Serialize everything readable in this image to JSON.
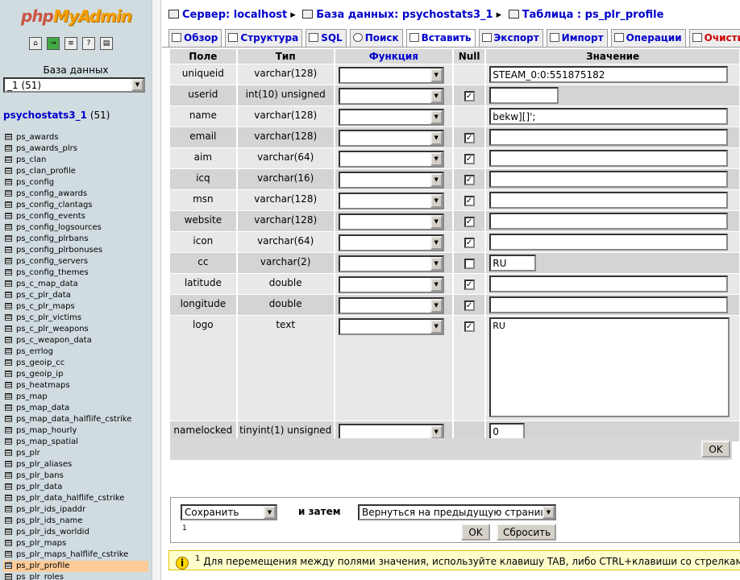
{
  "left": {
    "logo_php": "php",
    "logo_myadmin": "MyAdmin",
    "db_label": "База данных",
    "db_select": "_1 (51)",
    "db_name": "psychostats3_1",
    "db_count": "(51)",
    "tables": [
      "ps_awards",
      "ps_awards_plrs",
      "ps_clan",
      "ps_clan_profile",
      "ps_config",
      "ps_config_awards",
      "ps_config_clantags",
      "ps_config_events",
      "ps_config_logsources",
      "ps_config_plrbans",
      "ps_config_plrbonuses",
      "ps_config_servers",
      "ps_config_themes",
      "ps_c_map_data",
      "ps_c_plr_data",
      "ps_c_plr_maps",
      "ps_c_plr_victims",
      "ps_c_plr_weapons",
      "ps_c_weapon_data",
      "ps_errlog",
      "ps_geoip_cc",
      "ps_geoip_ip",
      "ps_heatmaps",
      "ps_map",
      "ps_map_data",
      "ps_map_data_halflife_cstrike",
      "ps_map_hourly",
      "ps_map_spatial",
      "ps_plr",
      "ps_plr_aliases",
      "ps_plr_bans",
      "ps_plr_data",
      "ps_plr_data_halflife_cstrike",
      "ps_plr_ids_ipaddr",
      "ps_plr_ids_name",
      "ps_plr_ids_worldid",
      "ps_plr_maps",
      "ps_plr_maps_halflife_cstrike",
      "ps_plr_profile",
      "ps_plr_roles"
    ],
    "selected_table": "ps_plr_profile"
  },
  "breadcrumb": {
    "server": "Сервер: localhost",
    "database": "База данных: psychostats3_1",
    "table": "Таблица : ps_plr_profile"
  },
  "tabs": [
    "Обзор",
    "Структура",
    "SQL",
    "Поиск",
    "Вставить",
    "Экспорт",
    "Импорт",
    "Операции",
    "Очисти"
  ],
  "active_tab": "Вставить",
  "columns": {
    "field": "Поле",
    "type": "Тип",
    "function": "Функция",
    "null": "Null",
    "value": "Значение"
  },
  "rows": [
    {
      "field": "uniqueid",
      "type": "varchar(128)",
      "null": false,
      "has_null": false,
      "value": "STEAM_0:0:551875182",
      "w": 296
    },
    {
      "field": "userid",
      "type": "int(10) unsigned",
      "null": true,
      "has_null": true,
      "value": "",
      "w": 86
    },
    {
      "field": "name",
      "type": "varchar(128)",
      "null": false,
      "has_null": false,
      "value": "bekw][]';",
      "w": 296
    },
    {
      "field": "email",
      "type": "varchar(128)",
      "null": true,
      "has_null": true,
      "value": "",
      "w": 296
    },
    {
      "field": "aim",
      "type": "varchar(64)",
      "null": true,
      "has_null": true,
      "value": "",
      "w": 296
    },
    {
      "field": "icq",
      "type": "varchar(16)",
      "null": true,
      "has_null": true,
      "value": "",
      "w": 296
    },
    {
      "field": "msn",
      "type": "varchar(128)",
      "null": true,
      "has_null": true,
      "value": "",
      "w": 296
    },
    {
      "field": "website",
      "type": "varchar(128)",
      "null": true,
      "has_null": true,
      "value": "",
      "w": 296
    },
    {
      "field": "icon",
      "type": "varchar(64)",
      "null": true,
      "has_null": true,
      "value": "",
      "w": 296
    },
    {
      "field": "cc",
      "type": "varchar(2)",
      "null": false,
      "has_null": true,
      "value": "RU",
      "w": 58
    },
    {
      "field": "latitude",
      "type": "double",
      "null": true,
      "has_null": true,
      "value": "",
      "w": 296
    },
    {
      "field": "longitude",
      "type": "double",
      "null": true,
      "has_null": true,
      "value": "",
      "w": 296
    },
    {
      "field": "logo",
      "type": "text",
      "null": true,
      "has_null": true,
      "value": "RU",
      "textarea": true
    },
    {
      "field": "namelocked",
      "type": "tinyint(1) unsigned",
      "null": false,
      "has_null": false,
      "value": "0",
      "w": 44
    }
  ],
  "ok_label": "OK",
  "save": {
    "action": "Сохранить",
    "then_label": "и затем",
    "after": "Вернуться на предыдущую страницу",
    "footnote": "1",
    "ok_label": "OK",
    "reset_label": "Сбросить"
  },
  "tip": {
    "sup": "1",
    "text": "Для перемещения между полями значения, используйте клавишу TAB, либо CTRL+клавиши со стрелками - д"
  }
}
